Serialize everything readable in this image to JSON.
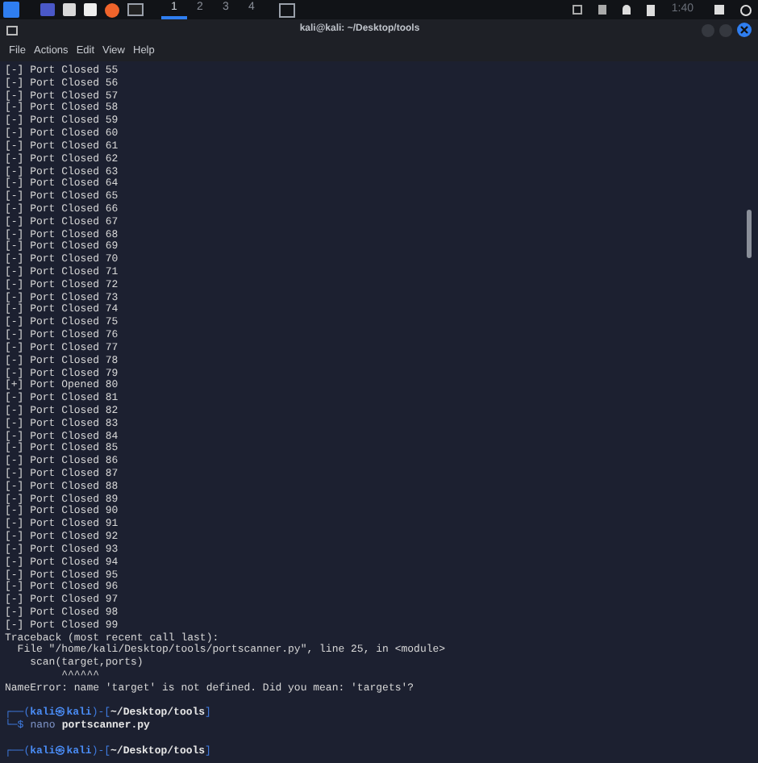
{
  "taskbar": {
    "workspaces": [
      {
        "label": "1",
        "selected": true
      },
      {
        "label": "2",
        "selected": false
      },
      {
        "label": "3",
        "selected": false
      },
      {
        "label": "4",
        "selected": false
      }
    ],
    "clock": "1:40"
  },
  "window": {
    "title": "kali@kali: ~/Desktop/tools"
  },
  "menu": [
    "File",
    "Actions",
    "Edit",
    "View",
    "Help"
  ],
  "blocks": [
    {
      "lines": [
        {
          "kind": "text",
          "text": "[-] Port Closed 55"
        },
        {
          "kind": "text",
          "text": "[-] Port Closed 56"
        },
        {
          "kind": "text",
          "text": "[-] Port Closed 57"
        },
        {
          "kind": "text",
          "text": "[-] Port Closed 58"
        },
        {
          "kind": "text",
          "text": "[-] Port Closed 59"
        },
        {
          "kind": "text",
          "text": "[-] Port Closed 60"
        },
        {
          "kind": "text",
          "text": "[-] Port Closed 61"
        },
        {
          "kind": "text",
          "text": "[-] Port Closed 62"
        },
        {
          "kind": "text",
          "text": "[-] Port Closed 63"
        },
        {
          "kind": "text",
          "text": "[-] Port Closed 64"
        },
        {
          "kind": "text",
          "text": "[-] Port Closed 65"
        },
        {
          "kind": "text",
          "text": "[-] Port Closed 66"
        },
        {
          "kind": "text",
          "text": "[-] Port Closed 67"
        },
        {
          "kind": "text",
          "text": "[-] Port Closed 68"
        },
        {
          "kind": "text",
          "text": "[-] Port Closed 69"
        },
        {
          "kind": "text",
          "text": "[-] Port Closed 70"
        },
        {
          "kind": "text",
          "text": "[-] Port Closed 71"
        },
        {
          "kind": "text",
          "text": "[-] Port Closed 72"
        },
        {
          "kind": "text",
          "text": "[-] Port Closed 73"
        },
        {
          "kind": "text",
          "text": "[-] Port Closed 74"
        },
        {
          "kind": "text",
          "text": "[-] Port Closed 75"
        },
        {
          "kind": "text",
          "text": "[-] Port Closed 76"
        },
        {
          "kind": "text",
          "text": "[-] Port Closed 77"
        },
        {
          "kind": "text",
          "text": "[-] Port Closed 78"
        },
        {
          "kind": "text",
          "text": "[-] Port Closed 79"
        },
        {
          "kind": "text",
          "text": "[+] Port Opened 80"
        },
        {
          "kind": "text",
          "text": "[-] Port Closed 81"
        },
        {
          "kind": "text",
          "text": "[-] Port Closed 82"
        },
        {
          "kind": "text",
          "text": "[-] Port Closed 83"
        },
        {
          "kind": "text",
          "text": "[-] Port Closed 84"
        },
        {
          "kind": "text",
          "text": "[-] Port Closed 85"
        },
        {
          "kind": "text",
          "text": "[-] Port Closed 86"
        },
        {
          "kind": "text",
          "text": "[-] Port Closed 87"
        },
        {
          "kind": "text",
          "text": "[-] Port Closed 88"
        },
        {
          "kind": "text",
          "text": "[-] Port Closed 89"
        },
        {
          "kind": "text",
          "text": "[-] Port Closed 90"
        },
        {
          "kind": "text",
          "text": "[-] Port Closed 91"
        },
        {
          "kind": "text",
          "text": "[-] Port Closed 92"
        },
        {
          "kind": "text",
          "text": "[-] Port Closed 93"
        },
        {
          "kind": "text",
          "text": "[-] Port Closed 94"
        },
        {
          "kind": "text",
          "text": "[-] Port Closed 95"
        },
        {
          "kind": "text",
          "text": "[-] Port Closed 96"
        },
        {
          "kind": "text",
          "text": "[-] Port Closed 97"
        },
        {
          "kind": "text",
          "text": "[-] Port Closed 98"
        },
        {
          "kind": "text",
          "text": "[-] Port Closed 99"
        },
        {
          "kind": "text",
          "text": "Traceback (most recent call last):"
        },
        {
          "kind": "text",
          "text": "  File \"/home/kali/Desktop/tools/portscanner.py\", line 25, in <module>"
        },
        {
          "kind": "text",
          "text": "    scan(target,ports)"
        },
        {
          "kind": "text",
          "text": "         ^^^^^^"
        },
        {
          "kind": "text",
          "text": "NameError: name 'target' is not defined. Did you mean: 'targets'?"
        }
      ]
    },
    {
      "lines": [
        {
          "kind": "prompt",
          "segments": [
            {
              "kind": "frame",
              "text": "┌──("
            },
            {
              "kind": "user",
              "text": "kali㉿kali"
            },
            {
              "kind": "frame",
              "text": ")-["
            },
            {
              "kind": "path",
              "text": "~/Desktop/tools"
            },
            {
              "kind": "frame",
              "text": "]"
            }
          ]
        },
        {
          "kind": "prompt",
          "segments": [
            {
              "kind": "frame",
              "text": "└─$"
            },
            {
              "kind": "cmd",
              "text": "nano"
            },
            {
              "kind": "arg",
              "text": "portscanner.py"
            }
          ]
        }
      ]
    },
    {
      "lines": [
        {
          "kind": "prompt",
          "segments": [
            {
              "kind": "frame",
              "text": "┌──("
            },
            {
              "kind": "user",
              "text": "kali㉿kali"
            },
            {
              "kind": "frame",
              "text": ")-["
            },
            {
              "kind": "path",
              "text": "~/Desktop/tools"
            },
            {
              "kind": "frame",
              "text": "]"
            }
          ]
        }
      ]
    }
  ]
}
